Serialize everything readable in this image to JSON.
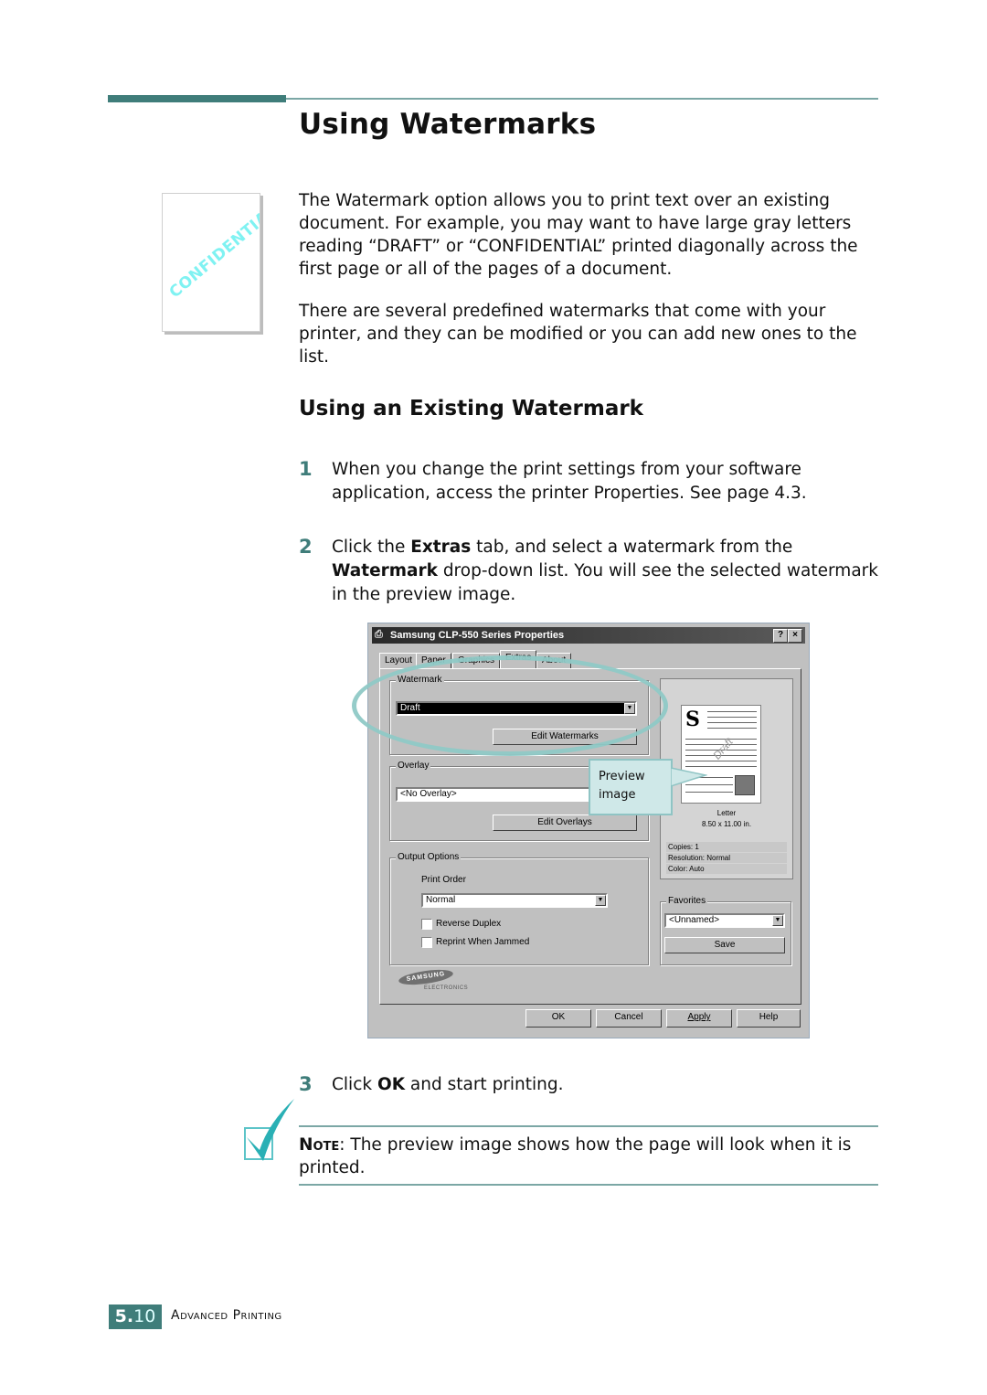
{
  "header": {
    "title": "Using Watermarks",
    "subtitle": "Using an Existing Watermark"
  },
  "thumbnail": {
    "watermark_text": "CONFIDENTIAL"
  },
  "intro": [
    "The Watermark option allows you to print text over an existing document. For example, you may want to have large gray letters reading “DRAFT” or “CONFIDENTIAL” printed diagonally across the first page or all of the pages of a document.",
    "There are several predefined watermarks that come with your printer, and they can be modified or you can add new ones to the list."
  ],
  "steps": [
    {
      "num": "1",
      "text": "When you change the print settings from your software application, access the printer Properties. See page 4.3."
    },
    {
      "num": "2",
      "pre": "Click the ",
      "b1": "Extras",
      "mid": " tab, and select a watermark from the ",
      "b2": "Watermark",
      "post": " drop-down list. You will see the selected watermark in the preview image."
    },
    {
      "num": "3",
      "pre": "Click ",
      "b1": "OK",
      "post": " and start printing."
    }
  ],
  "dialog": {
    "title": "Samsung CLP-550 Series Properties",
    "help_btn": "?",
    "close_btn": "×",
    "tabs": [
      "Layout",
      "Paper",
      "Graphics",
      "Extras",
      "About"
    ],
    "active_tab": "Extras",
    "watermark": {
      "label": "Watermark",
      "value": "Draft",
      "edit_btn": "Edit Watermarks"
    },
    "overlay": {
      "label": "Overlay",
      "value": "<No Overlay>",
      "edit_btn": "Edit Overlays"
    },
    "output": {
      "label": "Output Options",
      "print_order_label": "Print Order",
      "print_order_value": "Normal",
      "reverse_duplex": {
        "label": "Reverse Duplex",
        "checked": false
      },
      "reprint_jammed": {
        "label": "Reprint When Jammed",
        "checked": false
      }
    },
    "preview": {
      "watermark_text": "Draft",
      "paper": "Letter",
      "size": "8.50 x 11.00 in.",
      "info": [
        "Copies: 1",
        "Resolution: Normal",
        "Color: Auto"
      ]
    },
    "favorites": {
      "label": "Favorites",
      "value": "<Unnamed>",
      "save_btn": "Save"
    },
    "logo": {
      "brand": "SAMSUNG",
      "sub": "ELECTRONICS"
    },
    "buttons": {
      "ok": "OK",
      "cancel": "Cancel",
      "apply": "Apply",
      "help": "Help"
    }
  },
  "callout": {
    "line1": "Preview",
    "line2": "image"
  },
  "note": {
    "label": "Note",
    "text": ": The preview image shows how the page will look when it is printed."
  },
  "footer": {
    "chapter": "5.",
    "page": "10",
    "section": "Advanced Printing"
  },
  "colors": {
    "accent": "#3f7d7a",
    "callout_bg": "#cfe8e8",
    "highlight_ring": "#8fc9c6",
    "thumb_watermark": "#7ff2f2"
  }
}
